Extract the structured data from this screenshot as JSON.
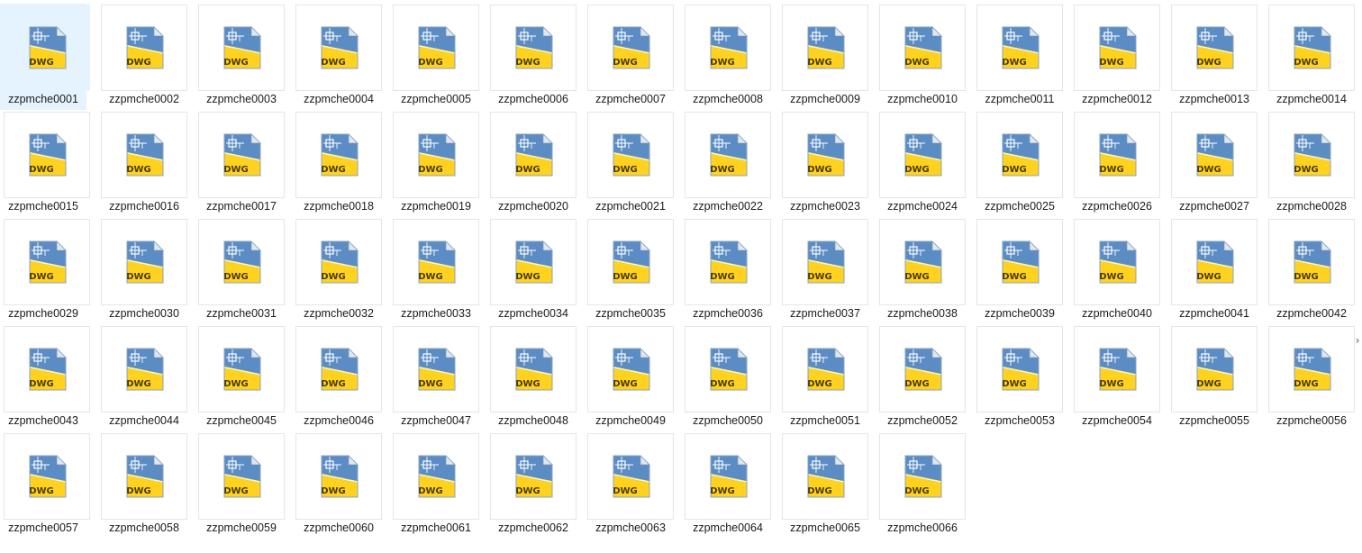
{
  "window": {
    "view": "large-icons"
  },
  "file_icon": {
    "name": "dwg-file-icon",
    "badge_text": "DWG",
    "colors": {
      "top_blue": "#1f4f8a",
      "mid_blue": "#5b8cc4",
      "yellow": "#ffd21f",
      "badge_text": "#4a3b00"
    }
  },
  "files": [
    {
      "name": "zzpmche0001",
      "selected": true
    },
    {
      "name": "zzpmche0002"
    },
    {
      "name": "zzpmche0003"
    },
    {
      "name": "zzpmche0004"
    },
    {
      "name": "zzpmche0005"
    },
    {
      "name": "zzpmche0006"
    },
    {
      "name": "zzpmche0007"
    },
    {
      "name": "zzpmche0008"
    },
    {
      "name": "zzpmche0009"
    },
    {
      "name": "zzpmche0010"
    },
    {
      "name": "zzpmche0011"
    },
    {
      "name": "zzpmche0012"
    },
    {
      "name": "zzpmche0013"
    },
    {
      "name": "zzpmche0014"
    },
    {
      "name": "zzpmche0015"
    },
    {
      "name": "zzpmche0016"
    },
    {
      "name": "zzpmche0017"
    },
    {
      "name": "zzpmche0018"
    },
    {
      "name": "zzpmche0019"
    },
    {
      "name": "zzpmche0020"
    },
    {
      "name": "zzpmche0021"
    },
    {
      "name": "zzpmche0022"
    },
    {
      "name": "zzpmche0023"
    },
    {
      "name": "zzpmche0024"
    },
    {
      "name": "zzpmche0025"
    },
    {
      "name": "zzpmche0026"
    },
    {
      "name": "zzpmche0027"
    },
    {
      "name": "zzpmche0028"
    },
    {
      "name": "zzpmche0029"
    },
    {
      "name": "zzpmche0030"
    },
    {
      "name": "zzpmche0031"
    },
    {
      "name": "zzpmche0032"
    },
    {
      "name": "zzpmche0033"
    },
    {
      "name": "zzpmche0034"
    },
    {
      "name": "zzpmche0035"
    },
    {
      "name": "zzpmche0036"
    },
    {
      "name": "zzpmche0037"
    },
    {
      "name": "zzpmche0038"
    },
    {
      "name": "zzpmche0039"
    },
    {
      "name": "zzpmche0040"
    },
    {
      "name": "zzpmche0041"
    },
    {
      "name": "zzpmche0042"
    },
    {
      "name": "zzpmche0043"
    },
    {
      "name": "zzpmche0044"
    },
    {
      "name": "zzpmche0045"
    },
    {
      "name": "zzpmche0046"
    },
    {
      "name": "zzpmche0047"
    },
    {
      "name": "zzpmche0048"
    },
    {
      "name": "zzpmche0049"
    },
    {
      "name": "zzpmche0050"
    },
    {
      "name": "zzpmche0051"
    },
    {
      "name": "zzpmche0052"
    },
    {
      "name": "zzpmche0053"
    },
    {
      "name": "zzpmche0054"
    },
    {
      "name": "zzpmche0055"
    },
    {
      "name": "zzpmche0056"
    },
    {
      "name": "zzpmche0057"
    },
    {
      "name": "zzpmche0058"
    },
    {
      "name": "zzpmche0059"
    },
    {
      "name": "zzpmche0060"
    },
    {
      "name": "zzpmche0061"
    },
    {
      "name": "zzpmche0062"
    },
    {
      "name": "zzpmche0063"
    },
    {
      "name": "zzpmche0064"
    },
    {
      "name": "zzpmche0065"
    },
    {
      "name": "zzpmche0066"
    }
  ],
  "scroll_arrow": {
    "glyph": "›",
    "icon": "chevron-right-icon"
  }
}
